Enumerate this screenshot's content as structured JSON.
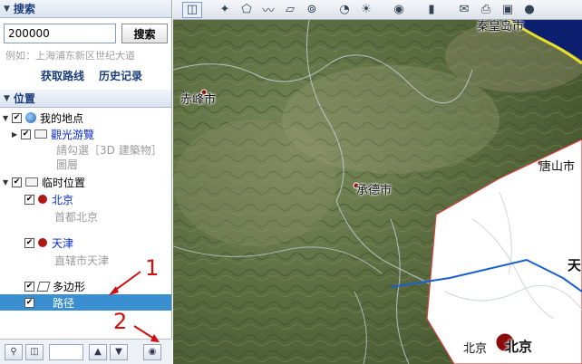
{
  "search": {
    "title": "搜索",
    "value": "200000",
    "button_label": "搜索",
    "example": "例如：上海浦东新区世纪大道",
    "get_route": "获取路线",
    "history": "历史记录"
  },
  "places": {
    "title": "位置",
    "my_places": "我的地点",
    "sightseeing": "觀光游覽",
    "sightseeing_desc_1": "請勾選［3D 建築物］",
    "sightseeing_desc_2": "圖層",
    "temp_places": "临时位置",
    "beijing": "北京",
    "beijing_desc": "首都北京",
    "tianjin": "天津",
    "tianjin_desc": "直辖市天津",
    "polygon": "多边形",
    "path": "路径"
  },
  "annotations": {
    "one": "1",
    "two": "2"
  },
  "map": {
    "cities": {
      "chifeng": "赤峰市",
      "chengde": "承德市",
      "tangshan": "唐山市",
      "qinhuangdao": "秦皇岛市",
      "tian": "天",
      "beijing_small": "北京",
      "beijing_big": "北京"
    }
  },
  "colors": {
    "accent": "#3a8fd0",
    "route": "#1a5fd0",
    "marker": "#b01818",
    "annotation": "#d01010"
  }
}
